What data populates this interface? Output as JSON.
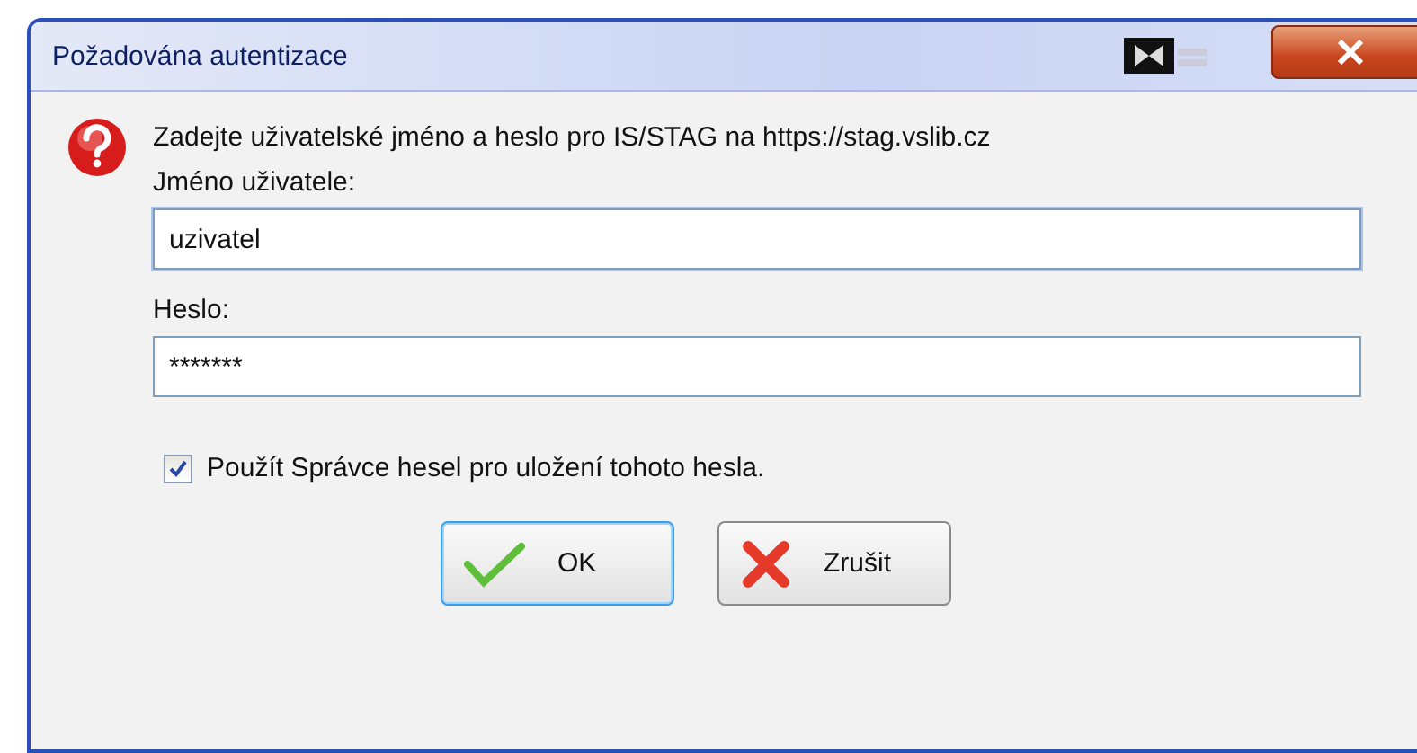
{
  "window": {
    "title": "Požadována autentizace"
  },
  "message": "Zadejte uživatelské jméno a heslo pro IS/STAG na https://stag.vslib.cz",
  "fields": [
    {
      "label": "Jméno uživatele:",
      "value": "uzivatel",
      "focused": true
    },
    {
      "label": "Heslo:",
      "value": "*******",
      "focused": false
    }
  ],
  "remember": {
    "label": "Použít Správce hesel pro uložení tohoto hesla.",
    "checked": true
  },
  "buttons": [
    {
      "label": "OK",
      "kind": "ok",
      "default": true
    },
    {
      "label": "Zrušit",
      "kind": "cancel",
      "default": false
    }
  ]
}
